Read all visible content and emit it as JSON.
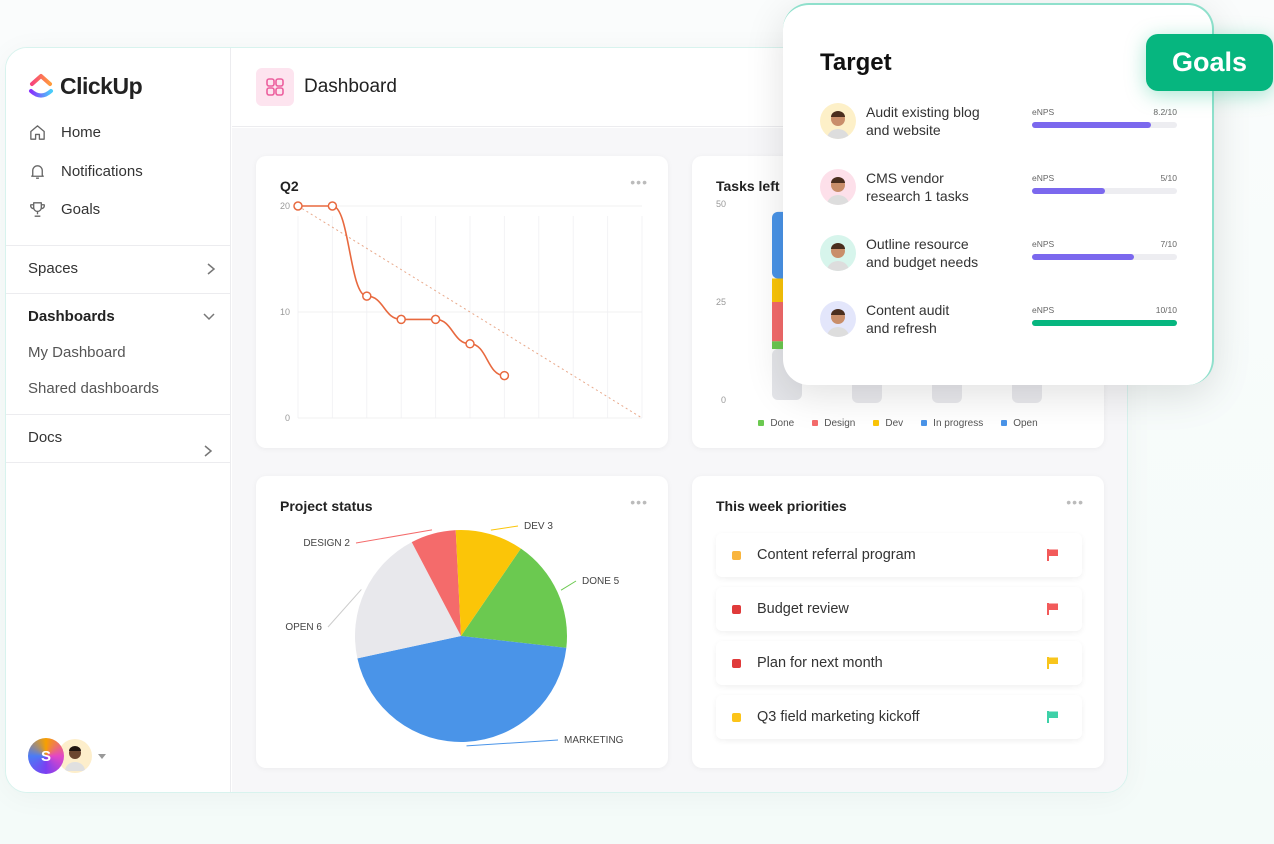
{
  "brand": {
    "name": "ClickUp"
  },
  "sidebar": {
    "nav": [
      {
        "label": "Home",
        "icon": "home-icon"
      },
      {
        "label": "Notifications",
        "icon": "bell-icon"
      },
      {
        "label": "Goals",
        "icon": "trophy-icon"
      }
    ],
    "spaces": {
      "label": "Spaces"
    },
    "dashboards": {
      "label": "Dashboards",
      "items": [
        "My Dashboard",
        "Shared dashboards"
      ]
    },
    "docs": {
      "label": "Docs"
    },
    "user": {
      "initial": "S"
    }
  },
  "header": {
    "title": "Dashboard"
  },
  "widgets": {
    "q2": {
      "title": "Q2",
      "menu": "•••"
    },
    "tasks_left": {
      "title": "Tasks left",
      "menu": "•••"
    },
    "project_status": {
      "title": "Project status",
      "menu": "•••"
    },
    "priorities": {
      "title": "This week priorities",
      "menu": "•••",
      "items": [
        {
          "label": "Content referral program",
          "status_color": "#f9b53e",
          "flag_color": "#f25a5a"
        },
        {
          "label": "Budget review",
          "status_color": "#e03a3a",
          "flag_color": "#f25a5a"
        },
        {
          "label": "Plan for next month",
          "status_color": "#e03a3a",
          "flag_color": "#f8c51c"
        },
        {
          "label": "Q3 field marketing kickoff",
          "status_color": "#fcc419",
          "flag_color": "#3ed1a8"
        }
      ]
    }
  },
  "target": {
    "title": "Target",
    "badge": "Goals",
    "goals": [
      {
        "label_line1": "Audit existing blog",
        "label_line2": "and website",
        "metric": "eNPS",
        "score": "8.2/10",
        "value": 8.2,
        "max": 10,
        "color": "#7b68ee",
        "avatar_bg": "#fdf0c8"
      },
      {
        "label_line1": "CMS vendor",
        "label_line2": "research 1 tasks",
        "metric": "eNPS",
        "score": "5/10",
        "value": 5,
        "max": 10,
        "color": "#7b68ee",
        "avatar_bg": "#fde0ea"
      },
      {
        "label_line1": "Outline resource",
        "label_line2": "and budget needs",
        "metric": "eNPS",
        "score": "7/10",
        "value": 7,
        "max": 10,
        "color": "#7b68ee",
        "avatar_bg": "#d7f5ec"
      },
      {
        "label_line1": "Content audit",
        "label_line2": "and refresh",
        "metric": "eNPS",
        "score": "10/10",
        "value": 10,
        "max": 10,
        "color": "#06b67f",
        "avatar_bg": "#e3e6fb"
      }
    ]
  },
  "chart_data": [
    {
      "type": "line",
      "title": "Q2",
      "yticks": [
        0,
        10,
        20
      ],
      "ylim": [
        0,
        20
      ],
      "x": [
        0,
        1,
        2,
        3,
        4,
        5,
        6
      ],
      "x_total": 10,
      "values": [
        20,
        20,
        11.5,
        9.3,
        9.3,
        7,
        4
      ],
      "ideal_line": {
        "from": 20,
        "to": 0
      },
      "line_color": "#e8693f"
    },
    {
      "type": "bar",
      "title": "Tasks left",
      "yticks": [
        0,
        25,
        50
      ],
      "ylim": [
        0,
        50
      ],
      "legend": [
        {
          "name": "Done",
          "color": "#6bc950"
        },
        {
          "name": "Design",
          "color": "#f46b6b"
        },
        {
          "name": "Dev",
          "color": "#fbc508"
        },
        {
          "name": "In progress",
          "color": "#4a94e8"
        },
        {
          "name": "Open",
          "color": "#4a94e8"
        }
      ],
      "visible_bar_stack": [
        {
          "name": "Open",
          "value": 13,
          "color": "#e4e5e9"
        },
        {
          "name": "Done",
          "value": 2,
          "color": "#6bc950"
        },
        {
          "name": "Design",
          "value": 10,
          "color": "#f46b6b"
        },
        {
          "name": "Dev",
          "value": 6,
          "color": "#fbc508"
        },
        {
          "name": "In progress",
          "value": 17,
          "color": "#4a94e8"
        }
      ]
    },
    {
      "type": "pie",
      "title": "Project status",
      "slices": [
        {
          "label": "DONE 5",
          "value": 5,
          "color": "#6bc950"
        },
        {
          "label": "MARKETING",
          "value": 13,
          "color": "#4a94e8"
        },
        {
          "label": "OPEN 6",
          "value": 6,
          "color": "#e8e8ec"
        },
        {
          "label": "DESIGN 2",
          "value": 2,
          "color": "#f46b6b"
        },
        {
          "label": "DEV 3",
          "value": 3,
          "color": "#fbc508"
        }
      ]
    }
  ]
}
